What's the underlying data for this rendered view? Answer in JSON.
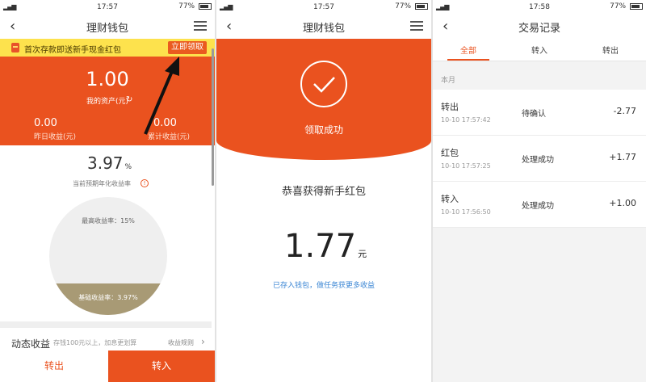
{
  "screen1": {
    "status": {
      "time": "17:57",
      "battery": "77%"
    },
    "nav": {
      "title": "理财钱包"
    },
    "banner": {
      "text": "首次存款即送新手现金红包",
      "button": "立即领取"
    },
    "assets": {
      "amount": "1.00",
      "label": "我的资产(元)",
      "yesterday_value": "0.00",
      "yesterday_label": "昨日收益(元)",
      "total_value": "0.00",
      "total_label": "累计收益(元)"
    },
    "rate": {
      "value": "3.97",
      "unit": "%",
      "label": "当前预期年化收益率"
    },
    "gauge": {
      "max_label": "最高收益率：15%",
      "base_label": "基础收益率：3.97%",
      "base_fraction": 0.265
    },
    "dynamic": {
      "title": "动态收益",
      "desc": "存钱100元以上，加息更划算",
      "rule": "收益规则"
    },
    "buttons": {
      "out": "转出",
      "in": "转入"
    }
  },
  "screen2": {
    "status": {
      "time": "17:57",
      "battery": "77%"
    },
    "nav": {
      "title": "理财钱包"
    },
    "success": "领取成功",
    "congrats": "恭喜获得新手红包",
    "bonus_amount": "1.77",
    "bonus_unit": "元",
    "note": "已存入钱包，做任务获更多收益"
  },
  "screen3": {
    "status": {
      "time": "17:58",
      "battery": "77%"
    },
    "nav": {
      "title": "交易记录"
    },
    "tabs": [
      "全部",
      "转入",
      "转出"
    ],
    "month": "本月",
    "records": [
      {
        "type": "转出",
        "time": "10-10 17:57:42",
        "state": "待确认",
        "amount": "-2.77"
      },
      {
        "type": "红包",
        "time": "10-10 17:57:25",
        "state": "处理成功",
        "amount": "+1.77"
      },
      {
        "type": "转入",
        "time": "10-10 17:56:50",
        "state": "处理成功",
        "amount": "+1.00"
      }
    ]
  },
  "colors": {
    "accent": "#ea521f",
    "banner": "#fde24d",
    "base_band": "#a89a75",
    "link": "#3b86d4"
  }
}
